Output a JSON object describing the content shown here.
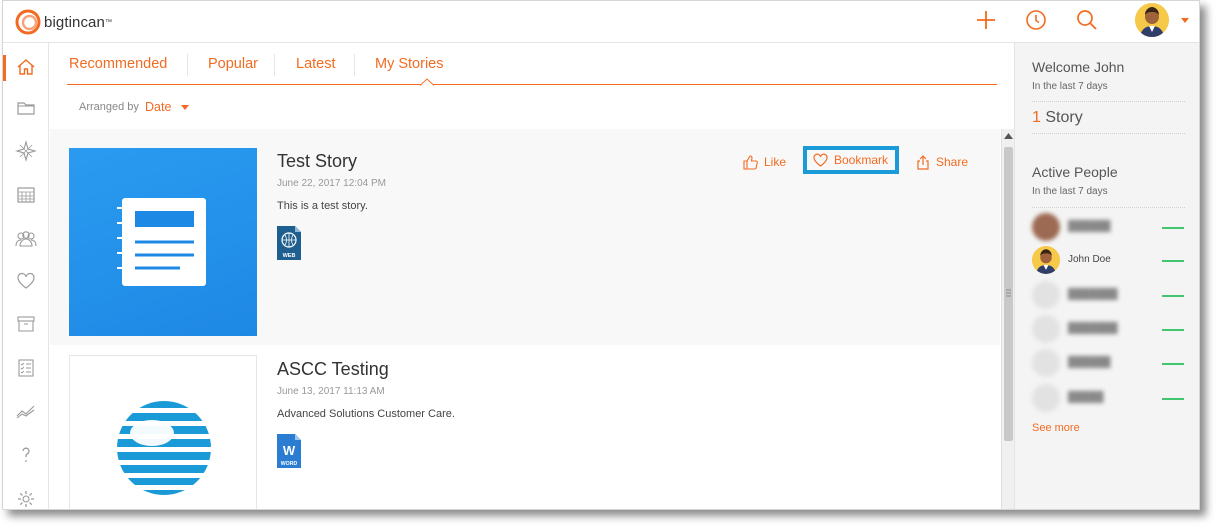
{
  "brand": {
    "name": "bigtincan",
    "accent": "#f26b21",
    "highlight": "#1a9bd7",
    "story_thumb": "#1e88e5"
  },
  "topbar": {
    "icons": [
      "plus-icon",
      "clock-icon",
      "search-icon"
    ],
    "user_menu_icon": "chevron-down-icon"
  },
  "leftnav": {
    "items": [
      {
        "icon": "home-icon",
        "active": true
      },
      {
        "icon": "folder-icon"
      },
      {
        "icon": "compass-icon"
      },
      {
        "icon": "calendar-icon"
      },
      {
        "icon": "people-icon"
      },
      {
        "icon": "heart-icon"
      },
      {
        "icon": "archive-icon"
      },
      {
        "icon": "checklist-icon"
      },
      {
        "icon": "analytics-icon"
      },
      {
        "icon": "help-icon"
      },
      {
        "icon": "gear-icon"
      }
    ]
  },
  "tabs": {
    "items": [
      {
        "label": "Recommended"
      },
      {
        "label": "Popular"
      },
      {
        "label": "Latest"
      },
      {
        "label": "My Stories",
        "selected": true
      }
    ]
  },
  "sort": {
    "label": "Arranged by",
    "value": "Date"
  },
  "stories": [
    {
      "title": "Test Story",
      "date": "June 22, 2017 12:04 PM",
      "description": "This is a test story.",
      "file_type": "WEB",
      "actions": {
        "like": "Like",
        "bookmark": "Bookmark",
        "share": "Share"
      }
    },
    {
      "title": "ASCC Testing",
      "date": "June 13, 2017 11:13 AM",
      "description": "Advanced Solutions Customer Care.",
      "file_type": "WORD"
    }
  ],
  "right_panel": {
    "welcome": "Welcome John",
    "welcome_sub": "In the last 7 days",
    "story_count": "1",
    "story_label": "Story",
    "active_people": "Active People",
    "active_sub": "In the last 7 days",
    "people": [
      {
        "name": "",
        "blurred": true
      },
      {
        "name": "John Doe",
        "blurred": false
      },
      {
        "name": "",
        "blurred": true
      },
      {
        "name": "",
        "blurred": true
      },
      {
        "name": "",
        "blurred": true
      },
      {
        "name": "",
        "blurred": true
      }
    ],
    "see_more": "See more"
  }
}
